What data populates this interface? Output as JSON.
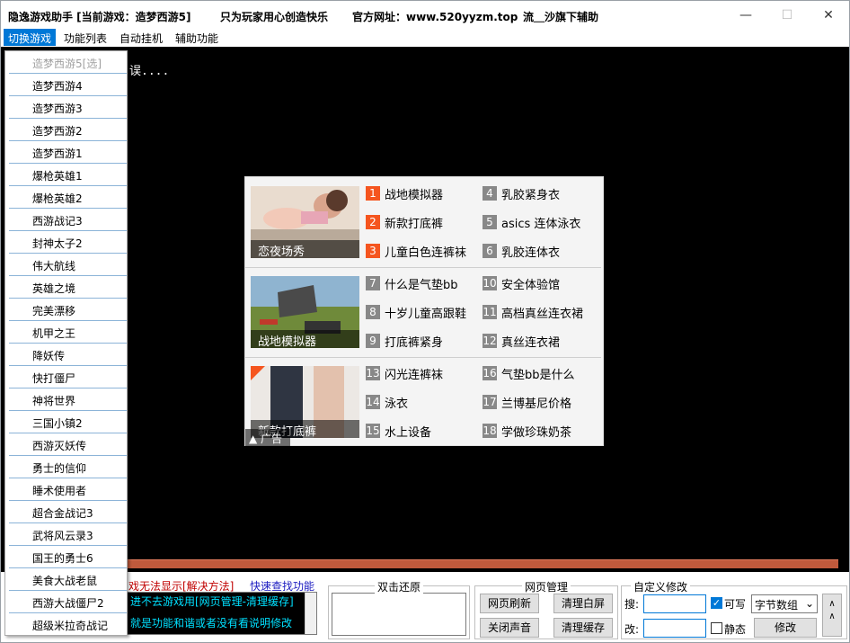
{
  "window": {
    "title_parts": [
      "隐逸游戏助手 [当前游戏：造梦西游5]",
      "只为玩家用心创造快乐",
      "官方网址：www.520yyzm.top",
      "流＿沙旗下辅助"
    ],
    "controls": [
      "—",
      "☐",
      "✕"
    ]
  },
  "menu": [
    "切换游戏",
    "功能列表",
    "自动挂机",
    "辅助功能"
  ],
  "dropdown": [
    "造梦西游5[选]",
    "造梦西游4",
    "造梦西游3",
    "造梦西游2",
    "造梦西游1",
    "爆枪英雄1",
    "爆枪英雄2",
    "西游战记3",
    "封神太子2",
    "伟大航线",
    "英雄之境",
    "完美漂移",
    "机甲之王",
    "降妖传",
    "快打僵尸",
    "神将世界",
    "三国小镇2",
    "西游灭妖传",
    "勇士的信仰",
    "睡术使用者",
    "超合金战记3",
    "武将风云录3",
    "国王的勇士6",
    "美食大战老鼠",
    "西游大战僵尸2",
    "超级米拉奇战记"
  ],
  "main": {
    "loading_text": "误....",
    "ad": {
      "sections": [
        {
          "caption": "恋夜场秀",
          "links": [
            {
              "num": "1",
              "text": "战地模拟器",
              "hot": true
            },
            {
              "num": "4",
              "text": "乳胶紧身衣",
              "hot": false
            },
            {
              "num": "2",
              "text": "新款打底裤",
              "hot": true
            },
            {
              "num": "5",
              "text": "asics 连体泳衣",
              "hot": false
            },
            {
              "num": "3",
              "text": "儿童白色连裤袜",
              "hot": true
            },
            {
              "num": "6",
              "text": "乳胶连体衣",
              "hot": false
            }
          ]
        },
        {
          "caption": "战地模拟器",
          "links": [
            {
              "num": "7",
              "text": "什么是气垫bb",
              "hot": false
            },
            {
              "num": "10",
              "text": "安全体验馆",
              "hot": false
            },
            {
              "num": "8",
              "text": "十岁儿童高跟鞋",
              "hot": false
            },
            {
              "num": "11",
              "text": "高档真丝连衣裙",
              "hot": false
            },
            {
              "num": "9",
              "text": "打底裤紧身",
              "hot": false
            },
            {
              "num": "12",
              "text": "真丝连衣裙",
              "hot": false
            }
          ]
        },
        {
          "caption": "新款打底裤",
          "links": [
            {
              "num": "13",
              "text": "闪光连裤袜",
              "hot": false
            },
            {
              "num": "16",
              "text": "气垫bb是什么",
              "hot": false
            },
            {
              "num": "14",
              "text": "泳衣",
              "hot": false
            },
            {
              "num": "17",
              "text": "兰博基尼价格",
              "hot": false
            },
            {
              "num": "15",
              "text": "水上设备",
              "hot": false
            },
            {
              "num": "18",
              "text": "学做珍珠奶茶",
              "hot": false
            }
          ]
        }
      ],
      "badge": "广告"
    }
  },
  "bottom": {
    "red_text": "戏无法显示[解决方法]",
    "quick_find": "快速查找功能",
    "help_line1": "进不去游戏用[网页管理-清理缓存]",
    "help_line2": "就是功能和谐或者没有看说明修改",
    "restore_label": "双击还原",
    "web_label": "网页管理",
    "web_buttons": [
      "网页刷新",
      "清理白屏",
      "关闭声音",
      "清理缓存"
    ],
    "custom_label": "自定义修改",
    "search_label": "搜:",
    "change_label": "改:",
    "writable_label": "可写",
    "static_label": "静态",
    "type_select": "字节数组",
    "modify_button": "修改"
  }
}
